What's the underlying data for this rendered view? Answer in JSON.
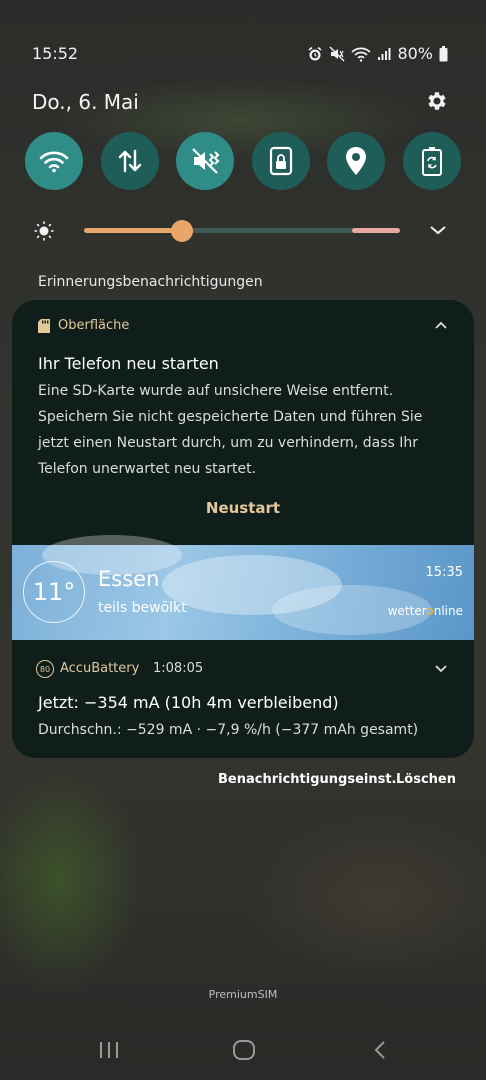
{
  "status_bar": {
    "time": "15:52",
    "battery": "80%",
    "icons": [
      "alarm-icon",
      "mute-icon",
      "wifi-icon",
      "signal-icon",
      "battery-icon"
    ]
  },
  "header": {
    "date": "Do., 6. Mai"
  },
  "quick_settings": [
    {
      "name": "wifi",
      "icon": "wifi-icon",
      "state": "on"
    },
    {
      "name": "mobile-data",
      "icon": "data-arrows-icon",
      "state": "off"
    },
    {
      "name": "sound",
      "icon": "vibrate-mute-icon",
      "state": "on"
    },
    {
      "name": "lock-rotation",
      "icon": "rotation-lock-icon",
      "state": "off"
    },
    {
      "name": "location",
      "icon": "location-pin-icon",
      "state": "off"
    },
    {
      "name": "power-saving",
      "icon": "battery-recycle-icon",
      "state": "off"
    }
  ],
  "brightness": {
    "level": 0.31
  },
  "section_label": "Erinnerungsbenachrichtigungen",
  "notifications": {
    "system": {
      "app": "Oberfläche",
      "title": "Ihr Telefon neu starten",
      "body": "Eine SD-Karte wurde auf unsichere Weise entfernt. Speichern Sie nicht gespeicherte Daten und führen Sie jetzt einen Neustart durch, um zu verhindern, dass Ihr Telefon unerwartet neu startet.",
      "action": "Neustart"
    },
    "weather": {
      "temperature": "11°",
      "city": "Essen",
      "condition": "teils bewölkt",
      "time": "15:35",
      "brand_prefix": "wetter",
      "brand_o": "o",
      "brand_suffix": "nline"
    },
    "battery": {
      "badge": "80",
      "app": "AccuBattery",
      "time": "1:08:05",
      "title": "Jetzt: −354 mA (10h 4m verbleibend)",
      "body": "Durchschn.: −529 mA · −7,9 %/h (−377 mAh gesamt)"
    }
  },
  "footer": {
    "settings": "Benachrichtigungseinst.",
    "clear": "Löschen"
  },
  "carrier": "PremiumSIM",
  "colors": {
    "accent": "#2f8c86",
    "card": "#0f1d1b",
    "app_label": "#e3c79a",
    "slider": "#e6a86a"
  }
}
